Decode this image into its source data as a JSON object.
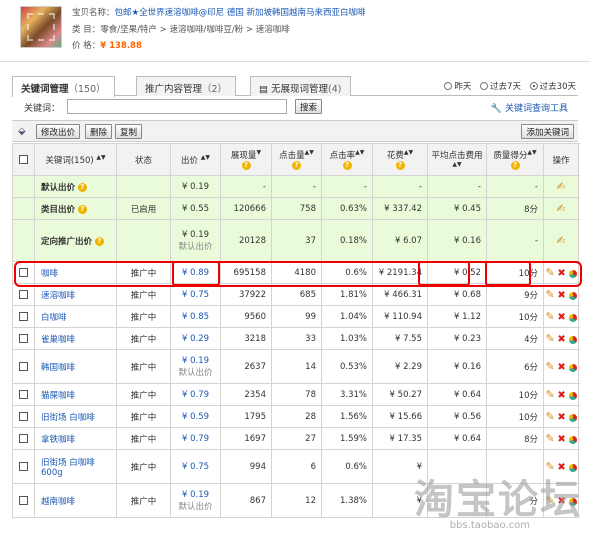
{
  "product": {
    "name_label": "宝贝名称：",
    "name": "包邮★全世界速溶咖啡@印尼 德国 新加坡韩国越南马来西亚白咖啡",
    "category_label": "类  目：",
    "category": "零食/坚果/特产 > 速溶咖啡/咖啡豆/粉 > 速溶咖啡",
    "price_label": "价    格：",
    "price": "¥ 138.88"
  },
  "tabs": [
    {
      "label": "关键词管理",
      "count": "（150）",
      "active": true
    },
    {
      "label": "推广内容管理",
      "count": "（2）",
      "active": false
    },
    {
      "label": "无展现词管理",
      "count": "(4)",
      "active": false
    }
  ],
  "date_range": {
    "options": [
      "昨天",
      "过去7天",
      "过去30天"
    ],
    "selected": "过去30天"
  },
  "search": {
    "label": "关键词：",
    "value": "",
    "button": "搜索",
    "tool_link": "关键词查询工具"
  },
  "actions": {
    "edit_bid": "修改出价",
    "delete": "删除",
    "copy": "复制",
    "add_keyword": "添加关键词"
  },
  "columns": [
    "关键词(150)",
    "状态",
    "出价",
    "展现量",
    "点击量",
    "点击率",
    "花费",
    "平均点击费用",
    "质量得分",
    "操作"
  ],
  "special_rows": [
    {
      "keyword": "默认出价",
      "status": "",
      "bid": "¥ 0.19",
      "bid_sub": "",
      "impr": "-",
      "clicks": "-",
      "ctr": "-",
      "cost": "-",
      "cpc": "-",
      "quality": "-"
    },
    {
      "keyword": "类目出价",
      "status": "已启用",
      "bid": "¥ 0.55",
      "bid_sub": "",
      "impr": "120666",
      "clicks": "758",
      "ctr": "0.63%",
      "cost": "¥ 337.42",
      "cpc": "¥ 0.45",
      "quality": "8分"
    },
    {
      "keyword": "定向推广出价",
      "status": "",
      "bid": "¥ 0.19",
      "bid_sub": "默认出价",
      "impr": "20128",
      "clicks": "37",
      "ctr": "0.18%",
      "cost": "¥ 6.07",
      "cpc": "¥ 0.16",
      "quality": "-"
    }
  ],
  "rows": [
    {
      "keyword": "咖啡",
      "status": "推广中",
      "bid": "¥ 0.89",
      "bid_sub": "",
      "impr": "695158",
      "clicks": "4180",
      "ctr": "0.6%",
      "cost": "¥ 2191.34",
      "cpc": "¥ 0.52",
      "quality": "10分"
    },
    {
      "keyword": "速溶咖啡",
      "status": "推广中",
      "bid": "¥ 0.75",
      "bid_sub": "",
      "impr": "37922",
      "clicks": "685",
      "ctr": "1.81%",
      "cost": "¥ 466.31",
      "cpc": "¥ 0.68",
      "quality": "9分"
    },
    {
      "keyword": "白咖啡",
      "status": "推广中",
      "bid": "¥ 0.85",
      "bid_sub": "",
      "impr": "9560",
      "clicks": "99",
      "ctr": "1.04%",
      "cost": "¥ 110.94",
      "cpc": "¥ 1.12",
      "quality": "10分"
    },
    {
      "keyword": "雀巢咖啡",
      "status": "推广中",
      "bid": "¥ 0.29",
      "bid_sub": "",
      "impr": "3218",
      "clicks": "33",
      "ctr": "1.03%",
      "cost": "¥ 7.55",
      "cpc": "¥ 0.23",
      "quality": "4分"
    },
    {
      "keyword": "韩国咖啡",
      "status": "推广中",
      "bid": "¥ 0.19",
      "bid_sub": "默认出价",
      "impr": "2637",
      "clicks": "14",
      "ctr": "0.53%",
      "cost": "¥ 2.29",
      "cpc": "¥ 0.16",
      "quality": "6分"
    },
    {
      "keyword": "猫屎咖啡",
      "status": "推广中",
      "bid": "¥ 0.79",
      "bid_sub": "",
      "impr": "2354",
      "clicks": "78",
      "ctr": "3.31%",
      "cost": "¥ 50.27",
      "cpc": "¥ 0.64",
      "quality": "10分"
    },
    {
      "keyword": "旧街场 白咖啡",
      "status": "推广中",
      "bid": "¥ 0.59",
      "bid_sub": "",
      "impr": "1795",
      "clicks": "28",
      "ctr": "1.56%",
      "cost": "¥ 15.66",
      "cpc": "¥ 0.56",
      "quality": "10分"
    },
    {
      "keyword": "拿铁咖啡",
      "status": "推广中",
      "bid": "¥ 0.79",
      "bid_sub": "",
      "impr": "1697",
      "clicks": "27",
      "ctr": "1.59%",
      "cost": "¥ 17.35",
      "cpc": "¥ 0.64",
      "quality": "8分"
    },
    {
      "keyword": "旧街场 白咖啡 600g",
      "status": "推广中",
      "bid": "¥ 0.75",
      "bid_sub": "",
      "impr": "994",
      "clicks": "6",
      "ctr": "0.6%",
      "cost": "¥",
      "cpc": "",
      "quality": ""
    },
    {
      "keyword": "越南咖啡",
      "status": "推广中",
      "bid": "¥ 0.19",
      "bid_sub": "默认出价",
      "impr": "867",
      "clicks": "12",
      "ctr": "1.38%",
      "cost": "¥",
      "cpc": "",
      "quality": "分"
    }
  ],
  "watermark": {
    "logo": "淘宝论坛",
    "url": "bbs.taobao.com"
  }
}
